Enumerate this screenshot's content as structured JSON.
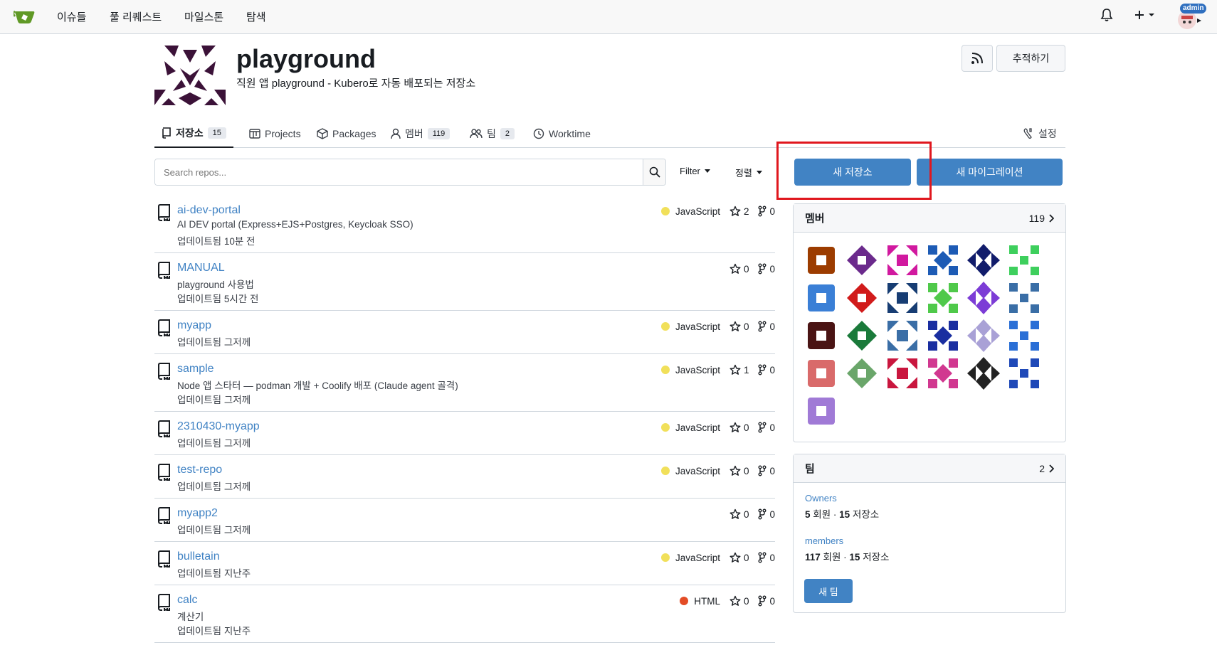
{
  "nav": {
    "links": [
      "이슈들",
      "풀 리퀘스트",
      "마일스톤",
      "탐색"
    ],
    "admin_badge": "admin"
  },
  "header": {
    "org_name": "playground",
    "description": "직원 앱 playground - Kubero로 자동 배포되는 저장소",
    "follow_label": "추적하기"
  },
  "tabs": {
    "repos": {
      "label": "저장소",
      "count": "15"
    },
    "projects": {
      "label": "Projects"
    },
    "packages": {
      "label": "Packages"
    },
    "members": {
      "label": "멤버",
      "count": "119"
    },
    "teams": {
      "label": "팀",
      "count": "2"
    },
    "worktime": {
      "label": "Worktime"
    },
    "settings": {
      "label": "설정"
    }
  },
  "search": {
    "placeholder": "Search repos...",
    "filter_label": "Filter",
    "sort_label": "정렬"
  },
  "actions": {
    "new_repo": "새 저장소",
    "new_migration": "새 마이그레이션"
  },
  "repos": [
    {
      "name": "ai-dev-portal",
      "desc": "AI DEV portal (Express+EJS+Postgres, Keycloak SSO)",
      "updated": "업데이트됨 10분 전",
      "lang": "JavaScript",
      "lang_color": "#f1e05a",
      "stars": "2",
      "forks": "0"
    },
    {
      "name": "MANUAL",
      "desc": "playground 사용법",
      "updated": "업데이트됨 5시간 전",
      "lang": "",
      "lang_color": "",
      "stars": "0",
      "forks": "0"
    },
    {
      "name": "myapp",
      "desc": "",
      "updated": "업데이트됨 그저께",
      "lang": "JavaScript",
      "lang_color": "#f1e05a",
      "stars": "0",
      "forks": "0"
    },
    {
      "name": "sample",
      "desc": "Node 앱 스타터 — podman 개발 + Coolify 배포 (Claude agent 골격)",
      "updated": "업데이트됨 그저께",
      "lang": "JavaScript",
      "lang_color": "#f1e05a",
      "stars": "1",
      "forks": "0"
    },
    {
      "name": "2310430-myapp",
      "desc": "",
      "updated": "업데이트됨 그저께",
      "lang": "JavaScript",
      "lang_color": "#f1e05a",
      "stars": "0",
      "forks": "0"
    },
    {
      "name": "test-repo",
      "desc": "",
      "updated": "업데이트됨 그저께",
      "lang": "JavaScript",
      "lang_color": "#f1e05a",
      "stars": "0",
      "forks": "0"
    },
    {
      "name": "myapp2",
      "desc": "",
      "updated": "업데이트됨 그저께",
      "lang": "",
      "lang_color": "",
      "stars": "0",
      "forks": "0"
    },
    {
      "name": "bulletain",
      "desc": "",
      "updated": "업데이트됨 지난주",
      "lang": "JavaScript",
      "lang_color": "#f1e05a",
      "stars": "0",
      "forks": "0"
    },
    {
      "name": "calc",
      "desc": "계산기",
      "updated": "업데이트됨 지난주",
      "lang": "HTML",
      "lang_color": "#e34c26",
      "stars": "0",
      "forks": "0"
    }
  ],
  "members_panel": {
    "title": "멤버",
    "count": "119",
    "avatar_colors": [
      "#9c3c00",
      "#6b2a8c",
      "#d1199f",
      "#1d5bb5",
      "#111c6b",
      "#3ecf5d",
      "#3a7fd6",
      "#d11b1b",
      "#173d73",
      "#4fc94a",
      "#7c3cd6",
      "#3a6ea6",
      "#4a1414",
      "#1a7a3a",
      "#3a6ea6",
      "#1a2ea0",
      "#a9a1d6",
      "#2a6fd6",
      "#d96a6a",
      "#6aa66a",
      "#c9163e",
      "#d13890",
      "#222222",
      "#1f49b8",
      "#a07ad6"
    ]
  },
  "teams_panel": {
    "title": "팀",
    "count": "2",
    "teams": [
      {
        "name": "Owners",
        "members": "5",
        "members_label": "회원",
        "repos": "15",
        "repos_label": "저장소"
      },
      {
        "name": "members",
        "members": "117",
        "members_label": "회원",
        "repos": "15",
        "repos_label": "저장소"
      }
    ],
    "new_team": "새 팀"
  }
}
